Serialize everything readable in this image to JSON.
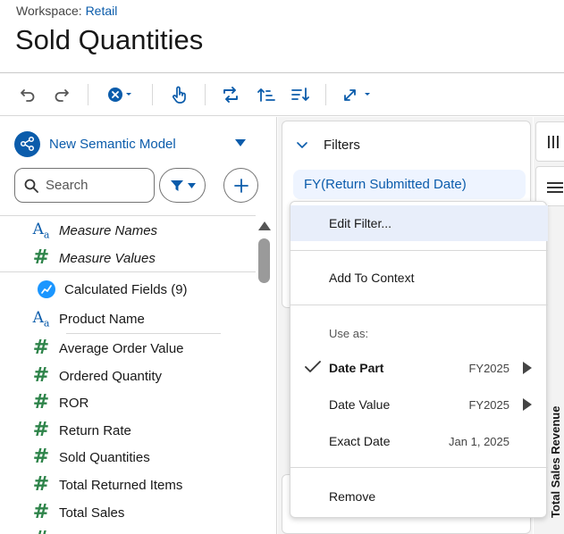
{
  "header": {
    "workspace_label": "Workspace:",
    "workspace_name": "Retail",
    "title": "Sold Quantities"
  },
  "toolbar": {
    "icons": [
      "undo-icon",
      "redo-icon",
      "clear-icon",
      "pointer-icon",
      "swap-icon",
      "sort-ascending-icon",
      "sort-descending-icon",
      "fit-icon"
    ]
  },
  "left_pane": {
    "model_name": "New Semantic Model",
    "search_placeholder": "Search",
    "fields": [
      {
        "type": "text",
        "label": "Measure Names",
        "italic": true
      },
      {
        "type": "number",
        "label": "Measure Values",
        "italic": true
      },
      {
        "type": "calc",
        "label": "Calculated Fields (9)"
      },
      {
        "type": "text",
        "label": "Product Name"
      },
      {
        "type": "number",
        "label": "Average Order Value"
      },
      {
        "type": "number",
        "label": "Ordered Quantity"
      },
      {
        "type": "number",
        "label": "ROR"
      },
      {
        "type": "number",
        "label": "Return Rate"
      },
      {
        "type": "number",
        "label": "Sold Quantities"
      },
      {
        "type": "number",
        "label": "Total Returned Items"
      },
      {
        "type": "number",
        "label": "Total Sales"
      }
    ]
  },
  "filters": {
    "title": "Filters",
    "pill": "FY(Return Submitted Date)"
  },
  "context_menu": {
    "edit_filter": "Edit Filter...",
    "add_to_context": "Add To Context",
    "use_as": "Use as:",
    "date_part": {
      "label": "Date Part",
      "value": "FY2025"
    },
    "date_value": {
      "label": "Date Value",
      "value": "FY2025"
    },
    "exact_date": {
      "label": "Exact Date",
      "value": "Jan 1, 2025"
    },
    "remove": "Remove"
  },
  "axis_label": "Total Sales Revenue",
  "colors": {
    "accent": "#0b5cab",
    "measure": "#2e844a",
    "highlight": "#e8eefa"
  }
}
